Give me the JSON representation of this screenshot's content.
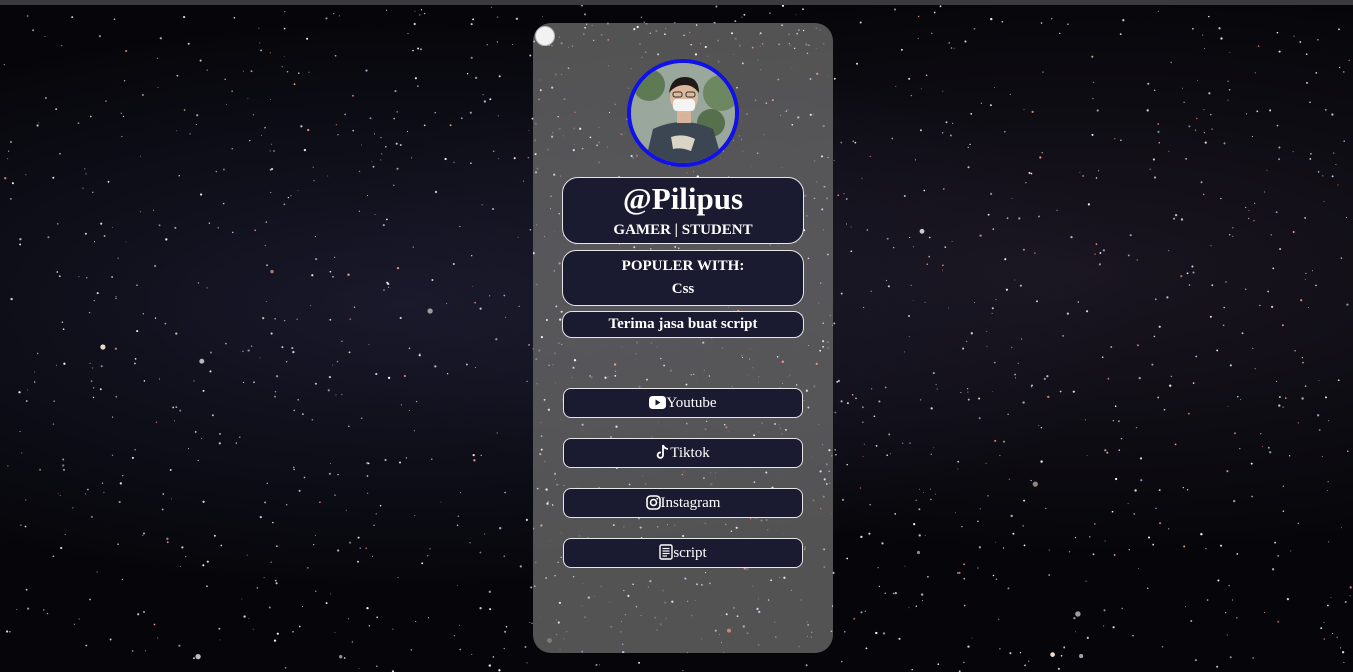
{
  "profile": {
    "handle": "@Pilipus",
    "tagline": "GAMER | STUDENT",
    "avatar_border_color": "#1010e8"
  },
  "popular": {
    "title": "POPULER WITH:",
    "value": "Css"
  },
  "note": "Terima jasa buat script",
  "links": [
    {
      "label": "Youtube",
      "icon": "youtube-icon"
    },
    {
      "label": "Tiktok",
      "icon": "tiktok-icon"
    },
    {
      "label": "Instagram",
      "icon": "instagram-icon"
    },
    {
      "label": "script",
      "icon": "script-icon"
    }
  ],
  "theme": {
    "panel_bg": "#1a1a30",
    "card_bg": "#696969",
    "text_color": "#ffffff"
  }
}
